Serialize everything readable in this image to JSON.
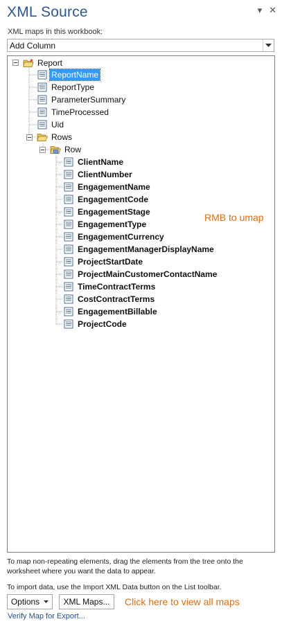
{
  "pane": {
    "title": "XML Source",
    "maps_label": "XML maps in this workbook:",
    "selected_map": "Add Column"
  },
  "tree": {
    "root": "Report",
    "report_children": [
      "ReportName",
      "ReportType",
      "ParameterSummary",
      "TimeProcessed",
      "Uid"
    ],
    "rows": "Rows",
    "row": "Row",
    "row_children": [
      "ClientName",
      "ClientNumber",
      "EngagementName",
      "EngagementCode",
      "EngagementStage",
      "EngagementType",
      "EngagementCurrency",
      "EngagementManagerDisplayName",
      "ProjectStartDate",
      "ProjectMainCustomerContactName",
      "TimeContractTerms",
      "CostContractTerms",
      "EngagementBillable",
      "ProjectCode"
    ],
    "selected": "ReportName"
  },
  "annotations": {
    "rmb_note": "RMB to umap",
    "click_note": "Click here to view all maps"
  },
  "help": {
    "drag_text": "To map non-repeating elements, drag the elements from the tree onto the worksheet where you want the data to appear.",
    "import_text": "To import data, use the Import XML Data button on the List toolbar."
  },
  "buttons": {
    "options": "Options",
    "xml_maps": "XML Maps...",
    "verify": "Verify Map for Export..."
  },
  "colors": {
    "title": "#2b5797",
    "annotation": "#e46c0a",
    "link": "#1f4e99",
    "selection": "#3399ff"
  }
}
